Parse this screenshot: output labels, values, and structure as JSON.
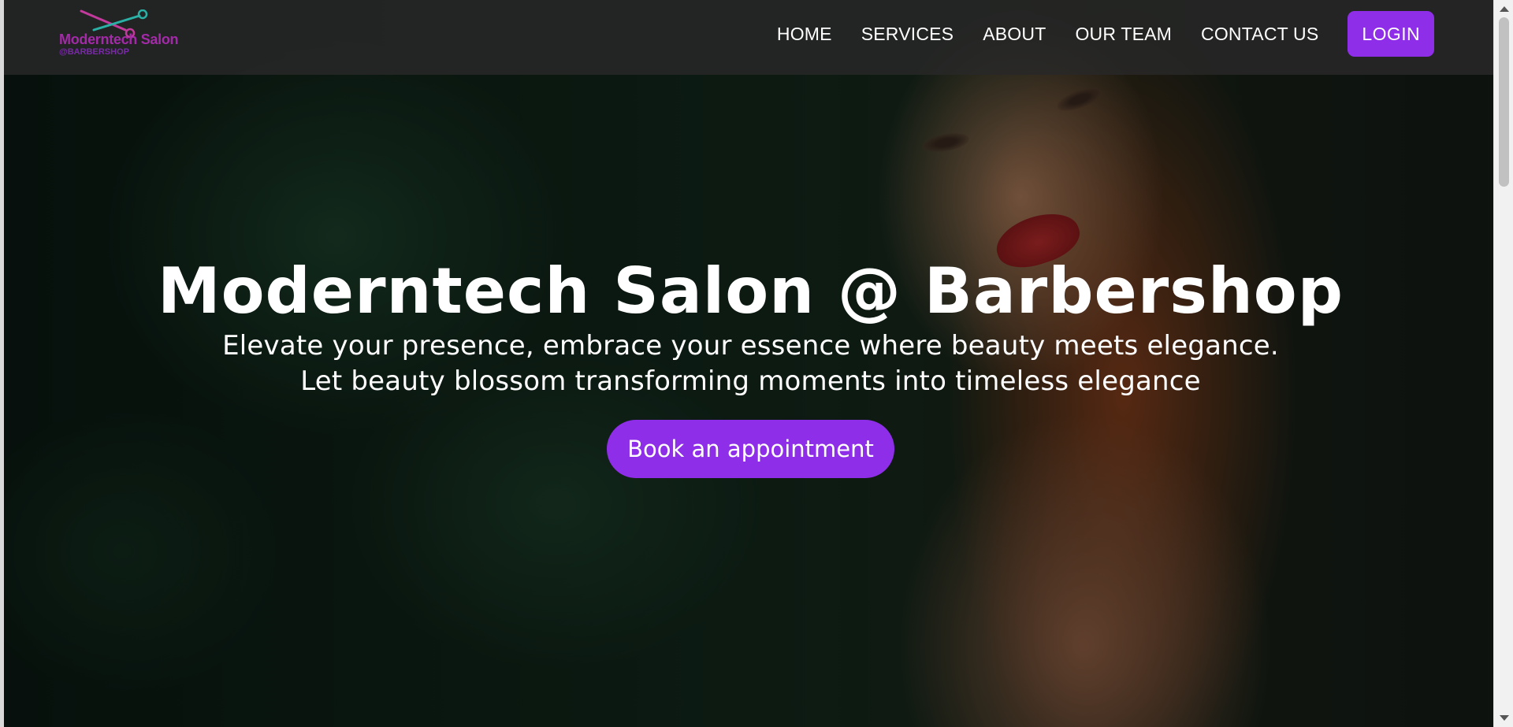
{
  "header": {
    "logo": {
      "line1": "Moderntech Salon",
      "line2": "@BARBERSHOP",
      "icon": "scissors-icon"
    },
    "nav": [
      {
        "label": "HOME"
      },
      {
        "label": "SERVICES"
      },
      {
        "label": "ABOUT"
      },
      {
        "label": "OUR TEAM"
      },
      {
        "label": "CONTACT US"
      }
    ],
    "login_label": "LOGIN"
  },
  "hero": {
    "title": "Moderntech Salon @ Barbershop",
    "subtitle_line1": "Elevate your presence, embrace your essence where beauty meets elegance.",
    "subtitle_line2": "Let beauty blossom transforming moments into timeless elegance",
    "cta_label": "Book an appointment"
  },
  "colors": {
    "accent": "#8f2ee8",
    "logo_primary": "#a32aa8",
    "logo_icon": "#2bb0a6",
    "nav_bg": "#282828",
    "text": "#ffffff"
  }
}
